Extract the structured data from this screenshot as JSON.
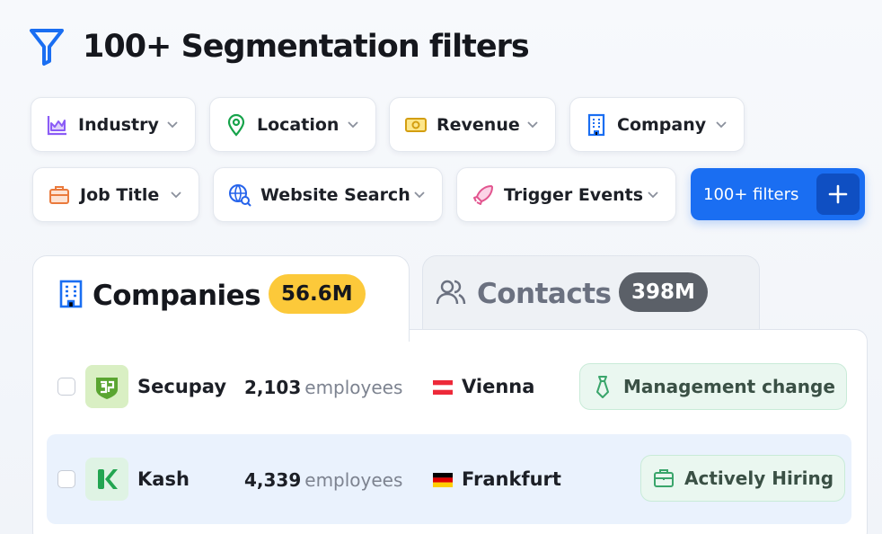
{
  "header": {
    "title": "100+ Segmentation filters",
    "icon": "funnel-icon"
  },
  "filters": [
    {
      "label": "Industry",
      "icon": "chart-icon"
    },
    {
      "label": "Location",
      "icon": "pin-icon"
    },
    {
      "label": "Revenue",
      "icon": "money-icon"
    },
    {
      "label": "Company",
      "icon": "building-icon"
    },
    {
      "label": "Job Title",
      "icon": "briefcase-icon"
    },
    {
      "label": "Website Search",
      "icon": "globe-search-icon"
    },
    {
      "label": "Trigger Events",
      "icon": "rocket-icon"
    }
  ],
  "more_filters": {
    "label": "100+ filters",
    "icon": "plus-icon"
  },
  "tabs": {
    "companies": {
      "label": "Companies",
      "count": "56.6M"
    },
    "contacts": {
      "label": "Contacts",
      "count": "398M"
    }
  },
  "rows": [
    {
      "name": "Secupay",
      "employees": "2,103",
      "employees_unit": "employees",
      "city": "Vienna",
      "flag": "austria",
      "event": "Management change",
      "event_icon": "tie-icon"
    },
    {
      "name": "Kash",
      "employees": "4,339",
      "employees_unit": "employees",
      "city": "Frankfurt",
      "flag": "germany",
      "event": "Actively Hiring",
      "event_icon": "briefcase-icon"
    }
  ],
  "colors": {
    "accent": "#1a6ef2",
    "badge_yellow": "#fcc93a",
    "badge_gray": "#5b6068"
  }
}
